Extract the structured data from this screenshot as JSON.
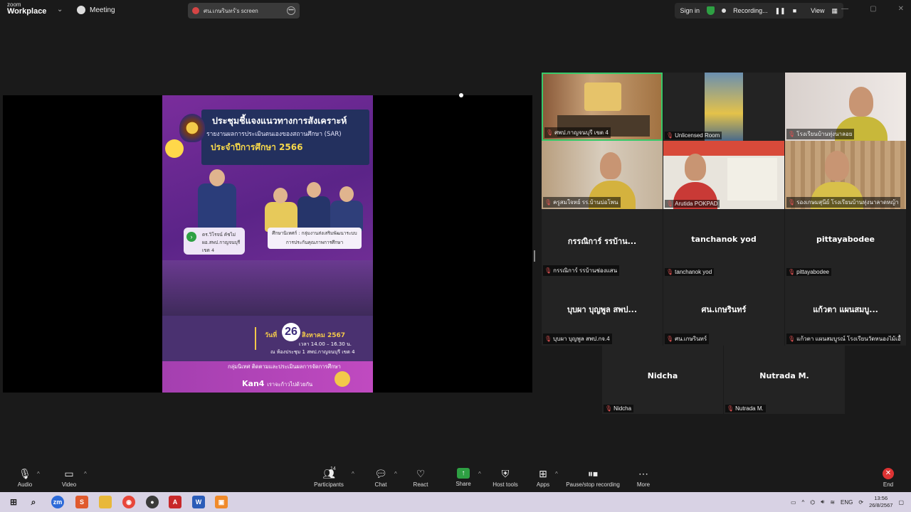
{
  "topbar": {
    "logo_line1": "zoom",
    "logo_line2": "Workplace",
    "meeting_label": "Meeting",
    "screen_tab_label": "ศน.เกษรินทร์'s screen",
    "sign_in": "Sign in",
    "recording": "Recording...",
    "view": "View"
  },
  "poster": {
    "title": "ประชุมชี้แจงแนวทางการสังเคราะห์",
    "subtitle": "รายงานผลการประเมินตนเองของสถานศึกษา (SAR)",
    "year": "ประจำปีการศึกษา 2566",
    "person_name": "ดร.วิโรจน์ คัชไม่",
    "person_role": "ผอ.สพป.กาญจนบุรี เขต 4",
    "group_line1": "ศึกษานิเทศก์ : กลุ่มงานส่งเสริมพัฒนาระบบ",
    "group_line2": "การประกันคุณภาพการศึกษา",
    "day_label": "วันที่",
    "day": "26",
    "month": "สิงหาคม 2567",
    "time": "เวลา 14.00 – 16.30 น.",
    "place": "ณ ห้องประชุม 1 สพป.กาญจนบุรี เขต 4",
    "footer1": "กลุ่มนิเทศ ติดตามและประเมินผลการจัดการศึกษา",
    "footer2": "Kan4",
    "footer2_tag": "เราจะก้าวไปด้วยกัน"
  },
  "participants": [
    {
      "name": "ศพป.กาญจนบุรี เขต 4",
      "big": ""
    },
    {
      "name": "Unlicensed Room",
      "big": ""
    },
    {
      "name": "โรงเรียนบ้านทุ่งนาลอย",
      "big": ""
    },
    {
      "name": "ครูสมใจหย์ รร.บ้านบ่อโพน",
      "big": ""
    },
    {
      "name": "Arutida POKPAD",
      "big": ""
    },
    {
      "name": "รองเกษมสุนีย์ โรงเรียนบ้านทุ่งนาลาดหญ้า",
      "big": ""
    },
    {
      "name": "กรรณิการ์ รรบ้านช่องแสน",
      "big": "กรรณิการ์ รรบ้าน..."
    },
    {
      "name": "tanchanok yod",
      "big": "tanchanok yod"
    },
    {
      "name": "pittayabodee",
      "big": "pittayabodee"
    },
    {
      "name": "บุบผา บุญพูล สพป.กจ.4",
      "big": "บุบผา บุญพูล สพป..."
    },
    {
      "name": "ศน.เกษรินทร์",
      "big": "ศน.เกษรินทร์"
    },
    {
      "name": "แก้วตา แผนสมบูรณ์ โรงเรียนวัดหนองไม้เอื้อย",
      "big": "แก้วตา แผนสมบู..."
    },
    {
      "name": "Nidcha",
      "big": "Nidcha"
    },
    {
      "name": "Nutrada M.",
      "big": "Nutrada M."
    }
  ],
  "toolbar": {
    "audio": "Audio",
    "video": "Video",
    "participants": "Participants",
    "participants_count": "14",
    "chat": "Chat",
    "react": "React",
    "share": "Share",
    "host_tools": "Host tools",
    "apps": "Apps",
    "pause_recording": "Pause/stop recording",
    "more": "More",
    "end": "End"
  },
  "taskbar": {
    "lang": "ENG",
    "time": "13:56",
    "date": "26/8/2567"
  },
  "colors": {
    "active_speaker": "#38c96a",
    "share_green": "#2ea043",
    "end_red": "#dd3333",
    "mic_off": "#e05252"
  }
}
